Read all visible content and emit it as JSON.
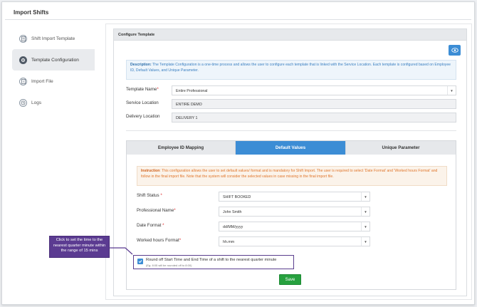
{
  "page": {
    "title": "Import Shifts"
  },
  "sidebar": {
    "items": [
      {
        "label": "Shift Import Template",
        "icon": "document-icon",
        "active": false
      },
      {
        "label": "Template Configuration",
        "icon": "cogs-icon",
        "active": true
      },
      {
        "label": "Import File",
        "icon": "upload-icon",
        "active": false
      },
      {
        "label": "Logs",
        "icon": "history-icon",
        "active": false
      }
    ]
  },
  "panel": {
    "header": "Configure Template",
    "description_label": "Description:",
    "description_text": " The Template Configuration is a one-time process and allows the user to configure each template that is linked with the Service Location. Each template is configured based on Employee ID, Default Values, and Unique Parameter."
  },
  "form": {
    "template_name_label": "Template Name",
    "template_name_value": "Entire Professional",
    "service_location_label": "Service Location",
    "service_location_value": "ENTIRE DEMO",
    "delivery_location_label": "Delivery Location",
    "delivery_location_value": "DELIVERY 1",
    "required_marker": "*"
  },
  "tabs": [
    {
      "label": "Employee ID Mapping",
      "active": false
    },
    {
      "label": "Default Values",
      "active": true
    },
    {
      "label": "Unique Parameter",
      "active": false
    }
  ],
  "default_values": {
    "instruction_label": "Instruction",
    "instruction_text": ": This configuration allows the user to set default values/ format and is mandatory for Shift Import. The user is required to select 'Date Format' and 'Worked hours Format' and follow in the final import file. Note that the system will consider the selected values in case missing in the final import file.",
    "shift_status_label": "Shift Status",
    "shift_status_value": "SHIFT BOOKED",
    "professional_name_label": "Professional Name",
    "professional_name_value": "John Smith",
    "date_format_label": "Date Format",
    "date_format_value": "dd/MM/yyyy",
    "worked_hours_label": "Worked hours Format",
    "worked_hours_value": "hh.mm",
    "round_off_label": "Round off Start Time and End Time of a shift to the nearest quarter minute",
    "round_off_hint": "(Eg: 8:05 will be rounded off to 8:00)",
    "round_off_checked": true,
    "save_label": "Save"
  },
  "callout": {
    "text": "Click to set the time to the nearest quarter minute within the range of 15 mins"
  },
  "colors": {
    "accent": "#3c8dd5",
    "save": "#27a13f",
    "callout": "#5b3b91",
    "instruction": "#e0752a"
  }
}
